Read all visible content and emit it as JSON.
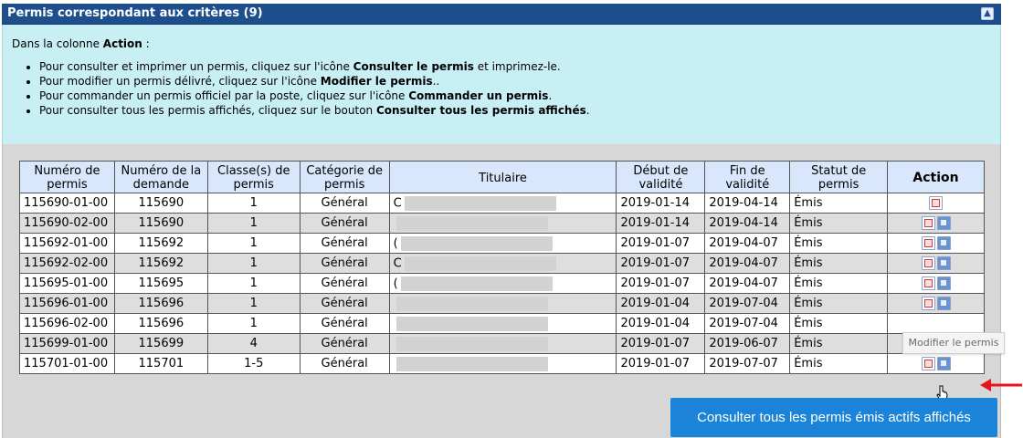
{
  "panel": {
    "title": "Permis correspondant aux critères (9)",
    "collapse_icon": "collapse-up-icon"
  },
  "info": {
    "intro_prefix": "Dans la colonne ",
    "intro_bold": "Action",
    "intro_suffix": " :",
    "bullets": [
      {
        "pre": "Pour consulter et imprimer un permis, cliquez sur l'icône ",
        "bold": "Consulter le permis",
        "post": " et imprimez-le."
      },
      {
        "pre": "Pour modifier un permis délivré, cliquez sur l'icône ",
        "bold": "Modifier le permis",
        "post": ".."
      },
      {
        "pre": "Pour commander un permis officiel par la poste, cliquez sur l'icône ",
        "bold": "Commander un permis",
        "post": "."
      },
      {
        "pre": "Pour consulter tous les permis affichés, cliquez sur le bouton ",
        "bold": "Consulter tous les permis affichés",
        "post": "."
      }
    ]
  },
  "table": {
    "headers": [
      "Numéro de permis",
      "Numéro de la demande",
      "Classe(s) de permis",
      "Catégorie de permis",
      "Titulaire",
      "Début de validité",
      "Fin de validité",
      "Statut de permis",
      "Action"
    ],
    "rows": [
      {
        "permis": "115690-01-00",
        "demande": "115690",
        "classe": "1",
        "categorie": "Général",
        "titulaire": "C",
        "debut": "2019-01-14",
        "fin": "2019-04-14",
        "statut": "Émis",
        "icons": [
          "view"
        ]
      },
      {
        "permis": "115690-02-00",
        "demande": "115690",
        "classe": "1",
        "categorie": "Général",
        "titulaire": "",
        "debut": "2019-01-14",
        "fin": "2019-04-14",
        "statut": "Émis",
        "icons": [
          "view",
          "edit"
        ]
      },
      {
        "permis": "115692-01-00",
        "demande": "115692",
        "classe": "1",
        "categorie": "Général",
        "titulaire": "(",
        "debut": "2019-01-07",
        "fin": "2019-04-07",
        "statut": "Émis",
        "icons": [
          "view",
          "edit"
        ]
      },
      {
        "permis": "115692-02-00",
        "demande": "115692",
        "classe": "1",
        "categorie": "Général",
        "titulaire": "C",
        "debut": "2019-01-07",
        "fin": "2019-04-07",
        "statut": "Émis",
        "icons": [
          "view",
          "edit"
        ]
      },
      {
        "permis": "115695-01-00",
        "demande": "115695",
        "classe": "1",
        "categorie": "Général",
        "titulaire": "(",
        "debut": "2019-01-07",
        "fin": "2019-04-07",
        "statut": "Émis",
        "icons": [
          "view",
          "edit"
        ]
      },
      {
        "permis": "115696-01-00",
        "demande": "115696",
        "classe": "1",
        "categorie": "Général",
        "titulaire": "",
        "debut": "2019-01-04",
        "fin": "2019-07-04",
        "statut": "Émis",
        "icons": [
          "view",
          "edit"
        ]
      },
      {
        "permis": "115696-02-00",
        "demande": "115696",
        "classe": "1",
        "categorie": "Général",
        "titulaire": "",
        "debut": "2019-01-04",
        "fin": "2019-07-04",
        "statut": "Émis",
        "icons": []
      },
      {
        "permis": "115699-01-00",
        "demande": "115699",
        "classe": "4",
        "categorie": "Général",
        "titulaire": "",
        "debut": "2019-01-07",
        "fin": "2019-06-07",
        "statut": "Émis",
        "icons": []
      },
      {
        "permis": "115701-01-00",
        "demande": "115701",
        "classe": "1-5",
        "categorie": "Général",
        "titulaire": "",
        "debut": "2019-01-07",
        "fin": "2019-07-07",
        "statut": "Émis",
        "icons": [
          "view",
          "edit"
        ]
      }
    ]
  },
  "tooltip": "Modifier le permis",
  "consult_button": "Consulter tous les permis émis actifs affichés",
  "colors": {
    "header_bg": "#1f4e8c",
    "info_bg": "#c7eff4",
    "button_bg": "#1b84d8",
    "arrow": "#e8141c"
  }
}
